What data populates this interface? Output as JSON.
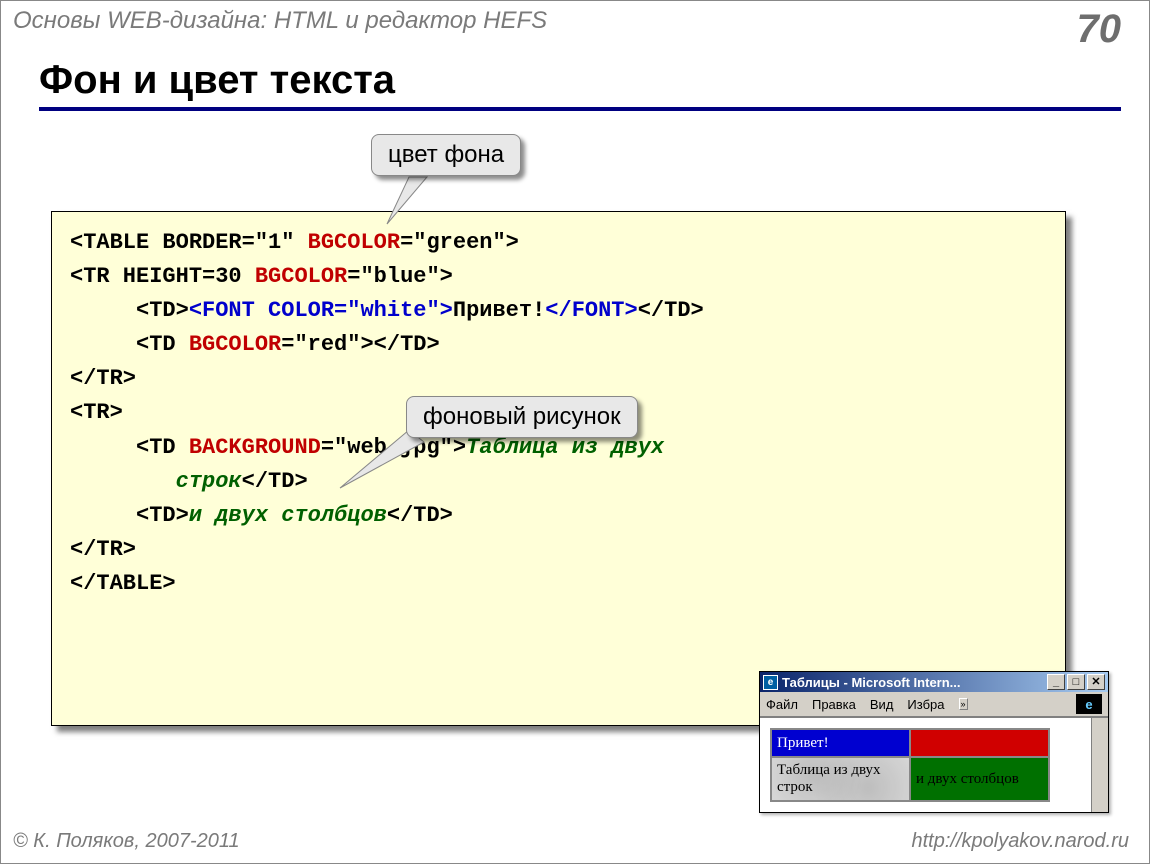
{
  "header": {
    "left": "Основы WEB-дизайна: HTML и редактор HEFS",
    "page_number": "70"
  },
  "title": "Фон и цвет текста",
  "callouts": {
    "bg_color": "цвет фона",
    "bg_image": "фоновый рисунок"
  },
  "code": {
    "l1_a": "<TABLE BORDER=\"1\" ",
    "l1_b": "BGCOLOR",
    "l1_c": "=\"green\">",
    "l2_a": "<TR HEIGHT=30 ",
    "l2_b": "BGCOLOR",
    "l2_c": "=\"blue\">",
    "l3_a": "     <TD>",
    "l3_b": "<FONT COLOR=\"white\">",
    "l3_c": "Привет!",
    "l3_d": "</FONT>",
    "l3_e": "</TD>",
    "l4_a": "     <TD ",
    "l4_b": "BGCOLOR",
    "l4_c": "=\"red\"></TD>",
    "l5": "</TR>",
    "l6": "<TR>",
    "l7_a": "     <TD ",
    "l7_b": "BACKGROUND",
    "l7_c": "=\"web.jpg\">",
    "l7_d": "Таблица из двух",
    "l8_a": "        строк",
    "l8_b": "</TD>",
    "l9_a": "     <TD>",
    "l9_b": "и двух столбцов",
    "l9_c": "</TD>",
    "l10": "</TR>",
    "l11": "</TABLE>"
  },
  "mini": {
    "title": "Таблицы - Microsoft Intern...",
    "menu": {
      "file": "Файл",
      "edit": "Правка",
      "view": "Вид",
      "fav": "Избра"
    },
    "cells": {
      "c11": "Привет!",
      "c12": "",
      "c21": "Таблица из двух строк",
      "c22": "и двух столбцов"
    }
  },
  "footer": {
    "copyright": "© К. Поляков, 2007-2011",
    "url": "http://kpolyakov.narod.ru"
  }
}
